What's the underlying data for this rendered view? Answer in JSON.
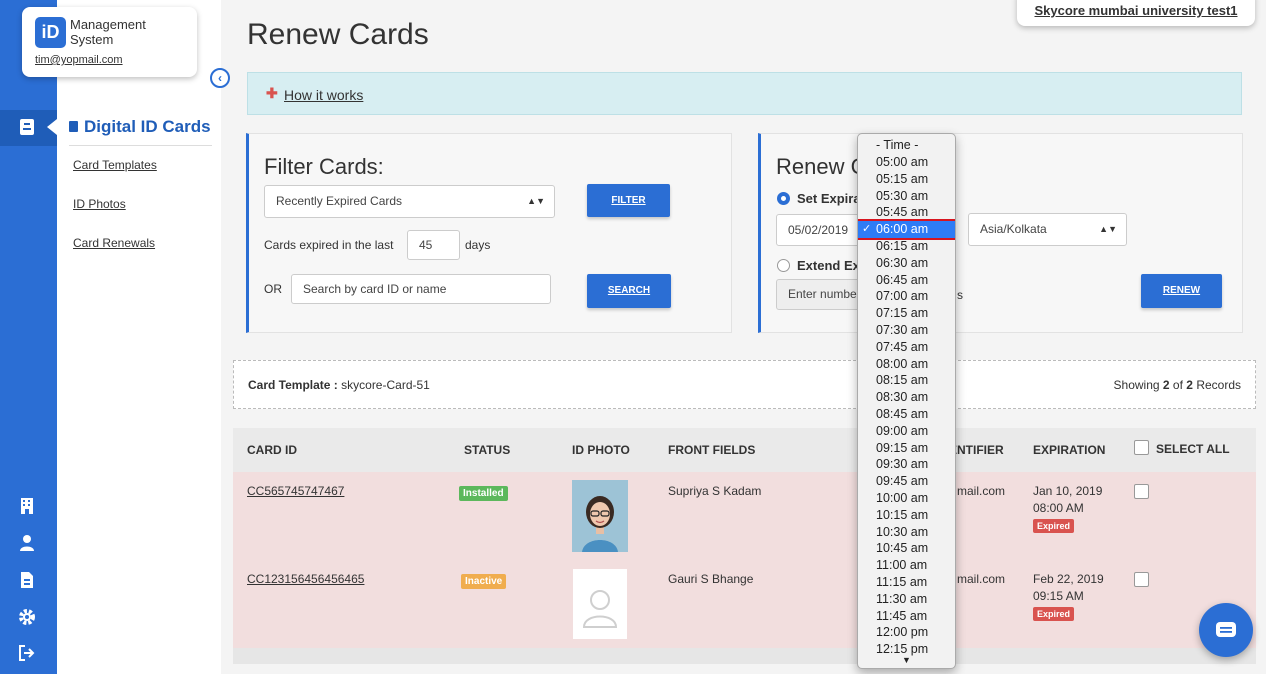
{
  "app": {
    "logo_badge": "iD",
    "logo_line1": "Management",
    "logo_line2": "System",
    "user_email": "tim@yopmail.com",
    "org_name": "Skycore mumbai university test1"
  },
  "sidebar": {
    "title": "Digital ID Cards",
    "links": [
      "Card Templates",
      "ID Photos",
      "Card Renewals"
    ]
  },
  "page": {
    "title": "Renew Cards",
    "how_it_works": "How it works"
  },
  "filter": {
    "title": "Filter Cards:",
    "select_value": "Recently Expired Cards",
    "filter_button": "FILTER",
    "expired_label": "Cards expired in the last",
    "days_value": "45",
    "days_label": "days",
    "or_label": "OR",
    "search_placeholder": "Search by card ID or name",
    "search_button": "SEARCH"
  },
  "renew": {
    "title_visible": "Renew C",
    "set_expiration_visible": "Set Expira",
    "date_value": "05/02/2019",
    "timezone_value": "Asia/Kolkata",
    "extend_visible": "Extend Exp",
    "number_placeholder_visible": "Enter numbe",
    "number_suffix_visible": "s",
    "renew_button": "RENEW"
  },
  "template_bar": {
    "label": "Card Template :",
    "value": "skycore-Card-51",
    "showing_prefix": "Showing",
    "showing_count": "2",
    "showing_of": "of",
    "showing_total": "2",
    "showing_suffix": "Records"
  },
  "table": {
    "headers": {
      "card_id": "CARD ID",
      "status": "STATUS",
      "id_photo": "ID PHOTO",
      "front_fields": "FRONT FIELDS",
      "identifier_visible": "ENTIFIER",
      "expiration": "EXPIRATION",
      "select_all": "SELECT ALL"
    },
    "rows": [
      {
        "card_id": "CC565745747467",
        "status": "Installed",
        "front_fields": "Supriya S Kadam",
        "identifier_visible": "mail.com",
        "exp_date": "Jan 10, 2019",
        "exp_time": "08:00 AM",
        "exp_badge": "Expired"
      },
      {
        "card_id": "CC123156456456465",
        "status": "Inactive",
        "front_fields": "Gauri S Bhange",
        "identifier_visible": "mail.com",
        "exp_date": "Feb 22, 2019",
        "exp_time": "09:15 AM",
        "exp_badge": "Expired"
      }
    ]
  },
  "time_dropdown": {
    "header": "- Time -",
    "selected": "06:00 am",
    "options": [
      "05:00 am",
      "05:15 am",
      "05:30 am",
      "05:45 am",
      "06:00 am",
      "06:15 am",
      "06:30 am",
      "06:45 am",
      "07:00 am",
      "07:15 am",
      "07:30 am",
      "07:45 am",
      "08:00 am",
      "08:15 am",
      "08:30 am",
      "08:45 am",
      "09:00 am",
      "09:15 am",
      "09:30 am",
      "09:45 am",
      "10:00 am",
      "10:15 am",
      "10:30 am",
      "10:45 am",
      "11:00 am",
      "11:15 am",
      "11:30 am",
      "11:45 am",
      "12:00 pm",
      "12:15 pm"
    ]
  },
  "colors": {
    "brand": "#2b6ed4",
    "installed": "#5cb85c",
    "inactive": "#f0ad4e",
    "expired": "#d9534f",
    "row_bg": "#f2dede",
    "selected_option": "#2e7cf6"
  }
}
